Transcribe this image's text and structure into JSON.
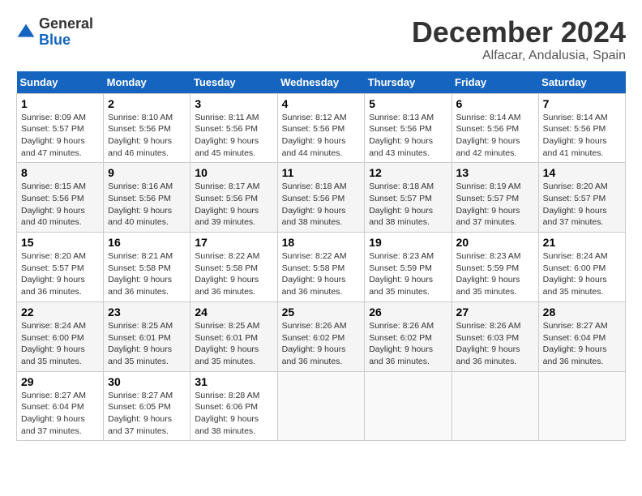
{
  "logo": {
    "general": "General",
    "blue": "Blue"
  },
  "header": {
    "month": "December 2024",
    "location": "Alfacar, Andalusia, Spain"
  },
  "weekdays": [
    "Sunday",
    "Monday",
    "Tuesday",
    "Wednesday",
    "Thursday",
    "Friday",
    "Saturday"
  ],
  "weeks": [
    [
      {
        "day": "1",
        "info": "Sunrise: 8:09 AM\nSunset: 5:57 PM\nDaylight: 9 hours and 47 minutes."
      },
      {
        "day": "2",
        "info": "Sunrise: 8:10 AM\nSunset: 5:56 PM\nDaylight: 9 hours and 46 minutes."
      },
      {
        "day": "3",
        "info": "Sunrise: 8:11 AM\nSunset: 5:56 PM\nDaylight: 9 hours and 45 minutes."
      },
      {
        "day": "4",
        "info": "Sunrise: 8:12 AM\nSunset: 5:56 PM\nDaylight: 9 hours and 44 minutes."
      },
      {
        "day": "5",
        "info": "Sunrise: 8:13 AM\nSunset: 5:56 PM\nDaylight: 9 hours and 43 minutes."
      },
      {
        "day": "6",
        "info": "Sunrise: 8:14 AM\nSunset: 5:56 PM\nDaylight: 9 hours and 42 minutes."
      },
      {
        "day": "7",
        "info": "Sunrise: 8:14 AM\nSunset: 5:56 PM\nDaylight: 9 hours and 41 minutes."
      }
    ],
    [
      {
        "day": "8",
        "info": "Sunrise: 8:15 AM\nSunset: 5:56 PM\nDaylight: 9 hours and 40 minutes."
      },
      {
        "day": "9",
        "info": "Sunrise: 8:16 AM\nSunset: 5:56 PM\nDaylight: 9 hours and 40 minutes."
      },
      {
        "day": "10",
        "info": "Sunrise: 8:17 AM\nSunset: 5:56 PM\nDaylight: 9 hours and 39 minutes."
      },
      {
        "day": "11",
        "info": "Sunrise: 8:18 AM\nSunset: 5:56 PM\nDaylight: 9 hours and 38 minutes."
      },
      {
        "day": "12",
        "info": "Sunrise: 8:18 AM\nSunset: 5:57 PM\nDaylight: 9 hours and 38 minutes."
      },
      {
        "day": "13",
        "info": "Sunrise: 8:19 AM\nSunset: 5:57 PM\nDaylight: 9 hours and 37 minutes."
      },
      {
        "day": "14",
        "info": "Sunrise: 8:20 AM\nSunset: 5:57 PM\nDaylight: 9 hours and 37 minutes."
      }
    ],
    [
      {
        "day": "15",
        "info": "Sunrise: 8:20 AM\nSunset: 5:57 PM\nDaylight: 9 hours and 36 minutes."
      },
      {
        "day": "16",
        "info": "Sunrise: 8:21 AM\nSunset: 5:58 PM\nDaylight: 9 hours and 36 minutes."
      },
      {
        "day": "17",
        "info": "Sunrise: 8:22 AM\nSunset: 5:58 PM\nDaylight: 9 hours and 36 minutes."
      },
      {
        "day": "18",
        "info": "Sunrise: 8:22 AM\nSunset: 5:58 PM\nDaylight: 9 hours and 36 minutes."
      },
      {
        "day": "19",
        "info": "Sunrise: 8:23 AM\nSunset: 5:59 PM\nDaylight: 9 hours and 35 minutes."
      },
      {
        "day": "20",
        "info": "Sunrise: 8:23 AM\nSunset: 5:59 PM\nDaylight: 9 hours and 35 minutes."
      },
      {
        "day": "21",
        "info": "Sunrise: 8:24 AM\nSunset: 6:00 PM\nDaylight: 9 hours and 35 minutes."
      }
    ],
    [
      {
        "day": "22",
        "info": "Sunrise: 8:24 AM\nSunset: 6:00 PM\nDaylight: 9 hours and 35 minutes."
      },
      {
        "day": "23",
        "info": "Sunrise: 8:25 AM\nSunset: 6:01 PM\nDaylight: 9 hours and 35 minutes."
      },
      {
        "day": "24",
        "info": "Sunrise: 8:25 AM\nSunset: 6:01 PM\nDaylight: 9 hours and 35 minutes."
      },
      {
        "day": "25",
        "info": "Sunrise: 8:26 AM\nSunset: 6:02 PM\nDaylight: 9 hours and 36 minutes."
      },
      {
        "day": "26",
        "info": "Sunrise: 8:26 AM\nSunset: 6:02 PM\nDaylight: 9 hours and 36 minutes."
      },
      {
        "day": "27",
        "info": "Sunrise: 8:26 AM\nSunset: 6:03 PM\nDaylight: 9 hours and 36 minutes."
      },
      {
        "day": "28",
        "info": "Sunrise: 8:27 AM\nSunset: 6:04 PM\nDaylight: 9 hours and 36 minutes."
      }
    ],
    [
      {
        "day": "29",
        "info": "Sunrise: 8:27 AM\nSunset: 6:04 PM\nDaylight: 9 hours and 37 minutes."
      },
      {
        "day": "30",
        "info": "Sunrise: 8:27 AM\nSunset: 6:05 PM\nDaylight: 9 hours and 37 minutes."
      },
      {
        "day": "31",
        "info": "Sunrise: 8:28 AM\nSunset: 6:06 PM\nDaylight: 9 hours and 38 minutes."
      },
      null,
      null,
      null,
      null
    ]
  ]
}
